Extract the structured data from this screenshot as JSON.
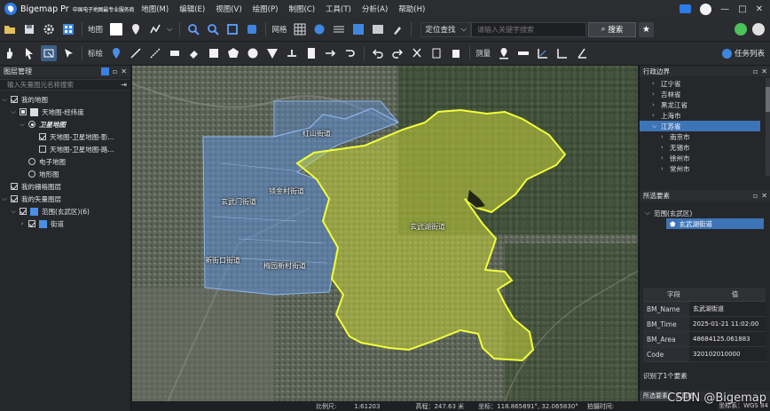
{
  "app": {
    "name": "Bigemap Pr",
    "name_ext": "中国电子地图最专业服务商"
  },
  "menu": [
    "地图(M)",
    "编辑(E)",
    "视图(V)",
    "绘图(P)",
    "制图(C)",
    "工具(T)",
    "分析(A)",
    "帮助(H)"
  ],
  "toolbar1": {
    "map_label": "地图",
    "grid_label": "网格",
    "search_mode": "定位查找",
    "search_placeholder": "请输入关键字搜索",
    "search_button": "搜索"
  },
  "toolbar2": {
    "mark_label": "标绘",
    "measure_label": "测量",
    "task_list": "任务列表"
  },
  "layer_panel": {
    "title": "图层管理",
    "search_placeholder": "输入矢量图元名称搜索",
    "tree": {
      "my_map": "我的地图",
      "tiandi": "天地图-经纬度",
      "satellite": "卫星地图",
      "sat_image": "天地图-卫星地图-影...",
      "sat_road": "天地图-卫星地图-路...",
      "electronic": "电子地图",
      "terrain": "地形图",
      "raster": "我的栅格图层",
      "vector": "我的矢量图层",
      "range": "范围(玄武区)(6)",
      "street": "街道"
    }
  },
  "map": {
    "labels": {
      "zijinshan": "紫金山街道",
      "hongshan": "红山街道",
      "xuanwumen": "玄武门街道",
      "suojincun": "锁金村街道",
      "xuanwuhu": "玄武湖街道",
      "xinjiekou": "新街口街道",
      "meiyuan": "梅园新村街道"
    }
  },
  "status": {
    "scale_label": "比例尺:",
    "scale_value": "1:61203",
    "elevation": "高程：247.63 米",
    "coords": "坐标：118.865891°, 32.065830°",
    "shot_time_label": "拍摄时间:",
    "crs": "坐标系：WGS 84"
  },
  "admin_panel": {
    "title": "行政边界",
    "provinces": [
      "辽宁省",
      "吉林省",
      "黑龙江省",
      "上海市",
      "江苏省"
    ],
    "cities": [
      "南京市",
      "无锡市",
      "徐州市",
      "常州市"
    ]
  },
  "selected_panel": {
    "title": "所选要素",
    "group": "范围(玄武区)",
    "item": "玄武湖街道",
    "col_field": "字段",
    "col_value": "值",
    "rows": [
      {
        "k": "BM_Name",
        "v": "玄武湖街道"
      },
      {
        "k": "BM_Time",
        "v": "2025-01-21 11:02:00"
      },
      {
        "k": "BM_Area",
        "v": "48684125.061883"
      },
      {
        "k": "Code",
        "v": "320102010000"
      }
    ],
    "identified": "识别了1个要素",
    "tabs": [
      "所选要素",
      "工具箱"
    ]
  },
  "watermark": "CSDN @Bigemap",
  "colors": {
    "accent": "#3d74b6",
    "highlight_fill": "#c9d63a",
    "highlight_stroke": "#f2ff3a",
    "district_fill": "#5f8fd6"
  }
}
